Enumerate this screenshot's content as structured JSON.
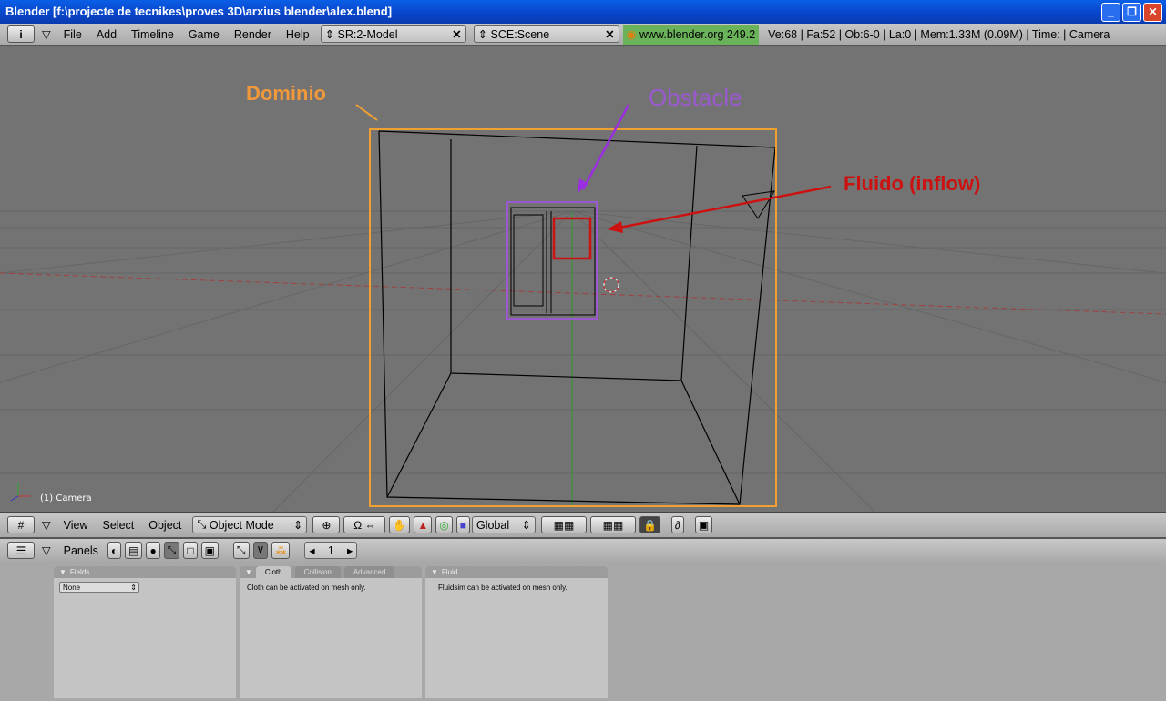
{
  "window": {
    "title": "Blender [f:\\projecte de tecnikes\\proves 3D\\arxius blender\\alex.blend]"
  },
  "menu": {
    "items": [
      "File",
      "Add",
      "Timeline",
      "Game",
      "Render",
      "Help"
    ],
    "screen": "SR:2-Model",
    "scene": "SCE:Scene",
    "version": "www.blender.org 249.2",
    "stats": "Ve:68 | Fa:52 | Ob:6-0 | La:0  | Mem:1.33M (0.09M)  | Time: | Camera"
  },
  "viewport": {
    "object_label": "(1) Camera",
    "annotations": {
      "domain": "Dominio",
      "obstacle": "Obstacle",
      "fluid": "Fluido (inflow)"
    },
    "colors": {
      "domain": "#f0a030",
      "obstacle": "#9b59d0",
      "fluid": "#cc1111"
    }
  },
  "view_header": {
    "items": [
      "View",
      "Select",
      "Object"
    ],
    "mode": "Object Mode",
    "orientation": "Global"
  },
  "buttons_header": {
    "panels_label": "Panels",
    "frame": "1"
  },
  "panels": {
    "fields": {
      "title": "Fields",
      "select": "None"
    },
    "cloth": {
      "tabs": [
        "Cloth",
        "Collision",
        "Advanced"
      ],
      "text": "Cloth can be activated on mesh only."
    },
    "fluid": {
      "title": "Fluid",
      "text": "Fluidsim can be activated on mesh only."
    }
  }
}
